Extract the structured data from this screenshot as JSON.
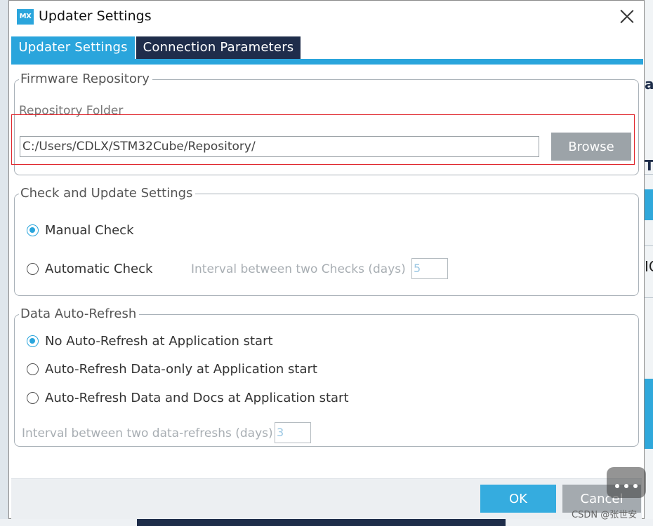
{
  "window": {
    "icon_text": "MX",
    "title": "Updater Settings"
  },
  "tabs": [
    {
      "label": "Updater Settings",
      "active": true
    },
    {
      "label": "Connection Parameters",
      "active": false
    }
  ],
  "firmware_repository": {
    "group_title": "Firmware Repository",
    "folder_label": "Repository Folder",
    "folder_path": "C:/Users/CDLX/STM32Cube/Repository/",
    "browse_label": "Browse"
  },
  "check_update": {
    "group_title": "Check and Update Settings",
    "manual_label": "Manual Check",
    "manual_checked": true,
    "automatic_label": "Automatic Check",
    "automatic_checked": false,
    "interval_label": "Interval between two Checks (days)",
    "interval_value": "5"
  },
  "data_refresh": {
    "group_title": "Data Auto-Refresh",
    "options": [
      {
        "label": "No Auto-Refresh at Application start",
        "checked": true
      },
      {
        "label": "Auto-Refresh Data-only at Application start",
        "checked": false
      },
      {
        "label": "Auto-Refresh Data and Docs at Application start",
        "checked": false
      }
    ],
    "interval_label": "Interval between two data-refreshs (days)",
    "interval_value": "3"
  },
  "footer": {
    "ok_label": "OK",
    "cancel_label": "Cancel"
  },
  "background": {
    "frag1": "ar",
    "frag2": "T",
    "frag3": "IC"
  },
  "watermark": "CSDN @张世安",
  "colors": {
    "accent": "#2aa5dc",
    "tab_inactive": "#1f2d4b",
    "highlight": "#e0282e",
    "button_gray": "#9ca3a8"
  }
}
